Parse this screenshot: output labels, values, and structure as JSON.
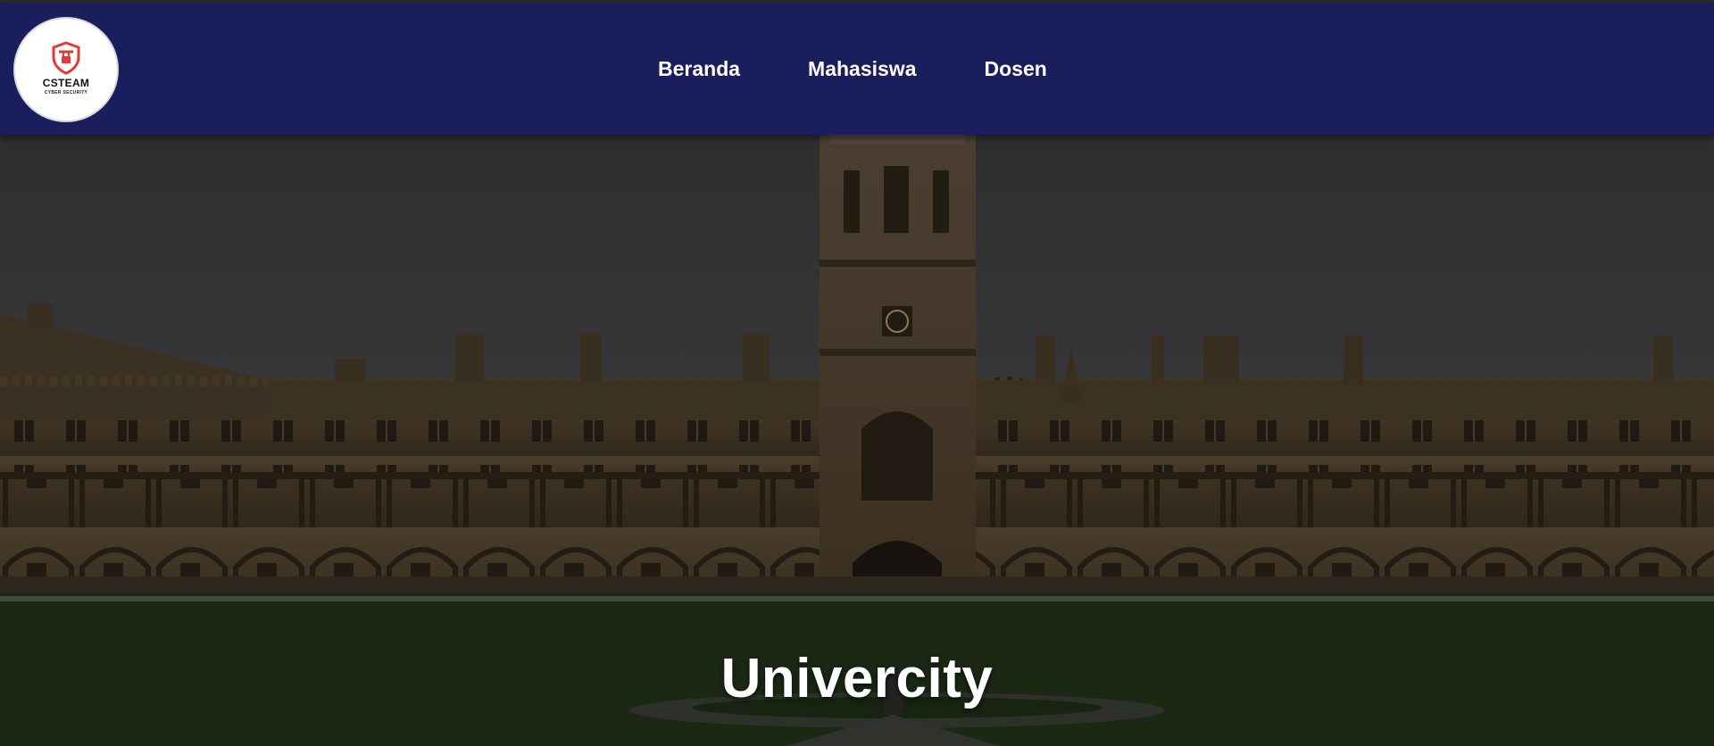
{
  "brand": {
    "logo_title": "CSTEAM",
    "logo_subtitle": "CYBER SECURITY",
    "logo_icon": "shield-icon",
    "accent": "#e53935"
  },
  "nav": {
    "items": [
      {
        "label": "Beranda"
      },
      {
        "label": "Mahasiswa"
      },
      {
        "label": "Dosen"
      }
    ],
    "background": "#1b1e5c"
  },
  "hero": {
    "title": "Univercity"
  }
}
